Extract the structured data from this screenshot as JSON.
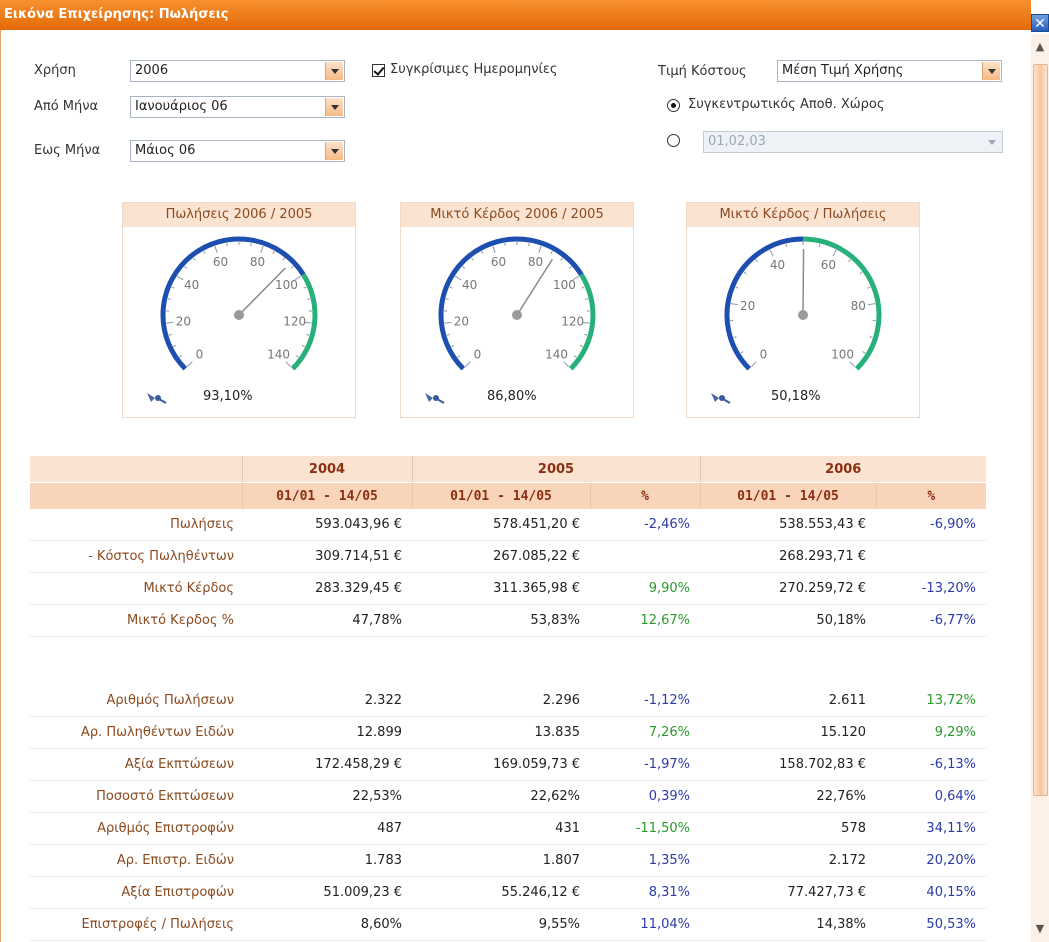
{
  "window": {
    "title": "Εικόνα Επιχείρησης: Πωλήσεις",
    "close_symbol": "✕"
  },
  "filters": {
    "year_label": "Χρήση",
    "year_value": "2006",
    "from_label": "Από Μήνα",
    "from_value": "Ιανουάριος 06",
    "to_label": "Εως Μήνα",
    "to_value": "Μάιος 06",
    "comparable_dates_label": "Συγκρίσιμες Ημερομηνίες",
    "cost_label": "Τιμή Κόστους",
    "cost_value": "Μέση Τιμή Χρήσης",
    "warehouse_total_label": "Συγκεντρωτικός Αποθ. Χώρος",
    "warehouse_codes_value": "01,02,03"
  },
  "gauges": [
    {
      "title": "Πωλήσεις 2006 / 2005",
      "ticks": [
        "0",
        "20",
        "40",
        "60",
        "80",
        "100",
        "120",
        "140"
      ],
      "max": 140,
      "needle": 93.1,
      "value_text": "93,10%"
    },
    {
      "title": "Μικτό Κέρδος 2006 / 2005",
      "ticks": [
        "0",
        "20",
        "40",
        "60",
        "80",
        "100",
        "120",
        "140"
      ],
      "max": 140,
      "needle": 86.8,
      "value_text": "86,80%"
    },
    {
      "title": "Μικτό Κέρδος / Πωλήσεις",
      "ticks": [
        "0",
        "20",
        "40",
        "60",
        "80",
        "100"
      ],
      "max": 100,
      "needle": 50.18,
      "value_text": "50,18%"
    }
  ],
  "table": {
    "years": [
      "2004",
      "2005",
      "2006"
    ],
    "date_range": "01/01 - 14/05",
    "pct_header": "%",
    "rows": [
      {
        "label": "Πωλήσεις",
        "v2004": "593.043,96 €",
        "v2005": "578.451,20 €",
        "p2005": "-2,46%",
        "v2006": "538.553,43 €",
        "p2006": "-6,90%"
      },
      {
        "label": "- Κόστος Πωληθέντων",
        "v2004": "309.714,51 €",
        "v2005": "267.085,22 €",
        "p2005": "",
        "v2006": "268.293,71 €",
        "p2006": ""
      },
      {
        "label": "Μικτό Κέρδος",
        "v2004": "283.329,45 €",
        "v2005": "311.365,98 €",
        "p2005": "9,90%",
        "v2006": "270.259,72 €",
        "p2006": "-13,20%"
      },
      {
        "label": "Μικτό Κερδος %",
        "v2004": "47,78%",
        "v2005": "53,83%",
        "p2005": "12,67%",
        "v2006": "50,18%",
        "p2006": "-6,77%"
      },
      {
        "label": "Αριθμός Πωλήσεων",
        "v2004": "2.322",
        "v2005": "2.296",
        "p2005": "-1,12%",
        "v2006": "2.611",
        "p2006": "13,72%"
      },
      {
        "label": "Αρ. Πωληθέντων Ειδών",
        "v2004": "12.899",
        "v2005": "13.835",
        "p2005": "7,26%",
        "v2006": "15.120",
        "p2006": "9,29%"
      },
      {
        "label": "Αξία Εκπτώσεων",
        "v2004": "172.458,29 €",
        "v2005": "169.059,73 €",
        "p2005": "-1,97%",
        "v2006": "158.702,83 €",
        "p2006": "-6,13%"
      },
      {
        "label": "Ποσοστό Εκπτώσεων",
        "v2004": "22,53%",
        "v2005": "22,62%",
        "p2005": "0,39%",
        "v2006": "22,76%",
        "p2006": "0,64%"
      },
      {
        "label": "Αριθμός Επιστροφών",
        "v2004": "487",
        "v2005": "431",
        "p2005": "-11,50%",
        "v2006": "578",
        "p2006": "34,11%"
      },
      {
        "label": "Αρ. Επιστρ. Ειδών",
        "v2004": "1.783",
        "v2005": "1.807",
        "p2005": "1,35%",
        "v2006": "2.172",
        "p2006": "20,20%"
      },
      {
        "label": "Αξία Επιστροφών",
        "v2004": "51.009,23 €",
        "v2005": "55.246,12 €",
        "p2005": "8,31%",
        "v2006": "77.427,73 €",
        "p2006": "40,15%"
      },
      {
        "label": "Επιστροφές / Πωλήσεις",
        "v2004": "8,60%",
        "v2005": "9,55%",
        "p2005": "11,04%",
        "v2006": "14,38%",
        "p2006": "50,53%"
      }
    ],
    "pct_colors": {
      "0": [
        "neg",
        "neg"
      ],
      "1": [
        "",
        ""
      ],
      "2": [
        "pos",
        "neg"
      ],
      "3": [
        "pos",
        "neg"
      ],
      "4": [
        "neg",
        "pos"
      ],
      "5": [
        "pos",
        "pos"
      ],
      "6": [
        "neg",
        "neg"
      ],
      "7": [
        "neg",
        "neg"
      ],
      "8": [
        "pos",
        "neg"
      ],
      "9": [
        "neg",
        "neg"
      ],
      "10": [
        "neg",
        "neg"
      ],
      "11": [
        "neg",
        "neg"
      ]
    }
  },
  "colors": {
    "titlebar": "#e46a08",
    "header_text": "#8a2f12",
    "positive": "#2a9a2a",
    "negative": "#2a3aa8"
  }
}
